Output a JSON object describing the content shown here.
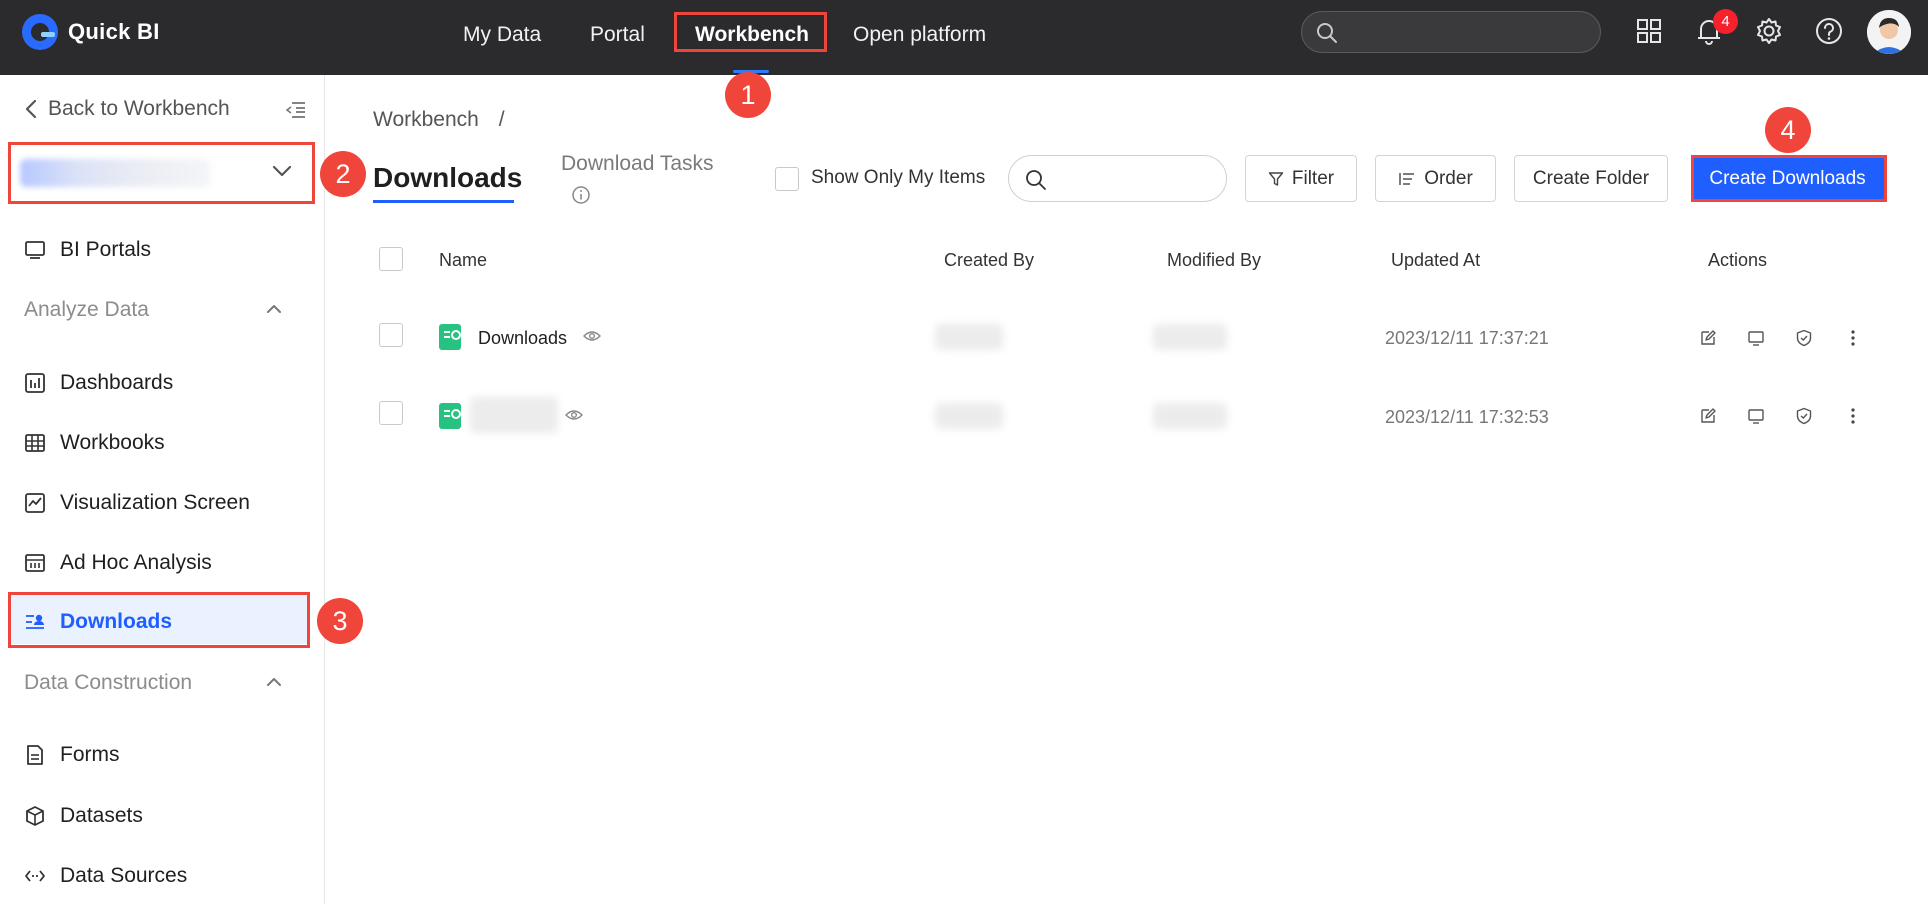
{
  "app": {
    "name": "Quick BI"
  },
  "topnav": {
    "items": [
      {
        "label": "My Data"
      },
      {
        "label": "Portal"
      },
      {
        "label": "Workbench",
        "active": true
      },
      {
        "label": "Open platform"
      }
    ],
    "notification_count": "4"
  },
  "sidebar": {
    "back_label": "Back to Workbench",
    "items": [
      {
        "label": "BI Portals",
        "icon": "monitor-icon"
      },
      {
        "label": "Dashboards",
        "icon": "dashboard-icon"
      },
      {
        "label": "Workbooks",
        "icon": "table-icon"
      },
      {
        "label": "Visualization Screen",
        "icon": "chart-screen-icon"
      },
      {
        "label": "Ad Hoc Analysis",
        "icon": "analysis-icon"
      },
      {
        "label": "Downloads",
        "icon": "download-list-icon",
        "active": true
      },
      {
        "label": "Forms",
        "icon": "form-icon"
      },
      {
        "label": "Datasets",
        "icon": "cube-icon"
      },
      {
        "label": "Data Sources",
        "icon": "data-source-icon"
      }
    ],
    "groups": [
      {
        "label": "Analyze Data"
      },
      {
        "label": "Data Construction"
      }
    ]
  },
  "main": {
    "breadcrumb": "Workbench",
    "breadcrumb_sep": "/",
    "tabs": [
      {
        "label": "Downloads",
        "active": true
      },
      {
        "label": "Download Tasks"
      }
    ],
    "show_only_mine_label": "Show Only My Items",
    "filter_label": "Filter",
    "order_label": "Order",
    "create_folder_label": "Create Folder",
    "create_downloads_label": "Create Downloads",
    "columns": {
      "name": "Name",
      "created_by": "Created By",
      "modified_by": "Modified By",
      "updated_at": "Updated At",
      "actions": "Actions"
    },
    "rows": [
      {
        "name": "Downloads",
        "updated_at": "2023/12/11 17:37:21"
      },
      {
        "name": "",
        "updated_at": "2023/12/11 17:32:53"
      }
    ]
  },
  "annotations": [
    "1",
    "2",
    "3",
    "4"
  ],
  "colors": {
    "accent": "#1f5eff",
    "highlight": "#f0453b",
    "topbar": "#2b2b2d"
  }
}
